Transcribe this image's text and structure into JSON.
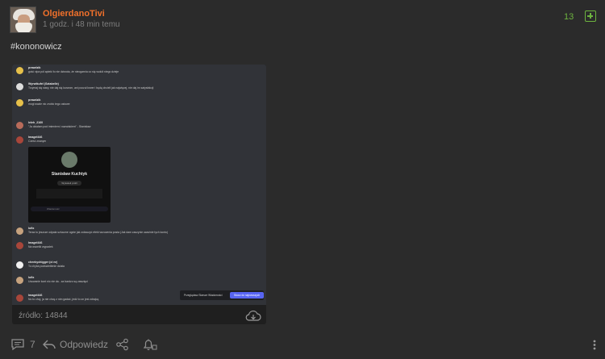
{
  "post": {
    "username": "OlgierdanoTivi",
    "time": "1 godz. i 48 min temu",
    "votes": "13",
    "hashtag": "#kononowicz",
    "source_label": "źródło: 14844"
  },
  "screenshot": {
    "messages": [
      {
        "name": "prawdzik",
        "text": "gość vipa pół apteki fo nie dziwota, że nieogarnia co się wokół niego dzieje"
      },
      {
        "name": "Wyrwikufel (Sztabelle)",
        "text": "Trzymaj się stary, nie daj się kurwom, ani poczuł krwer i będą chcieli jak najwięcej, nie daj im satysfakcji"
      },
      {
        "name": "prawdzik",
        "text": "mogl wcale nic zrobic tego ostowe"
      },
      {
        "name": "leleh_2160",
        "text": "\"Ja działam pod imieniem i nazwiskiem\" - Stanisław"
      },
      {
        "name": "Imagel446",
        "text": "Cześć znanym"
      },
      {
        "name": "lofix",
        "text": "Teraz to jeszcze odpala sztuczne ognie jak zobaczyć efekt wrzucenia posta (Jak dam zaczynie uważnie tych konto)"
      },
      {
        "name": "Imagel446",
        "text": "Na wszelki wypadek"
      },
      {
        "name": "cheekychigger (cl nr)",
        "text": "To chyba podświetlenie działa"
      },
      {
        "name": "lofix",
        "text": "Usuwanie kont nic nie da - za bardzo są zawzięci"
      },
      {
        "name": "Imagel446",
        "text": "No to chuj, ja nie chcę z nim gadać, jedź to on jest zdrajcą"
      }
    ],
    "profile_card": {
      "name": "Stanisław Kuchtyk",
      "chip": "Wyświetl profil",
      "input_placeholder": "Wiadomość"
    },
    "tooltip": {
      "label": "Przeglądasz Starsze Wiadomości",
      "button": "Skocz do najnowszych"
    }
  },
  "footer": {
    "comments_count": "7",
    "reply_label": "Odpowiedz"
  },
  "colors": {
    "accent_username": "#f0702b",
    "vote_green": "#6db33f",
    "background": "#2b2b2b"
  }
}
